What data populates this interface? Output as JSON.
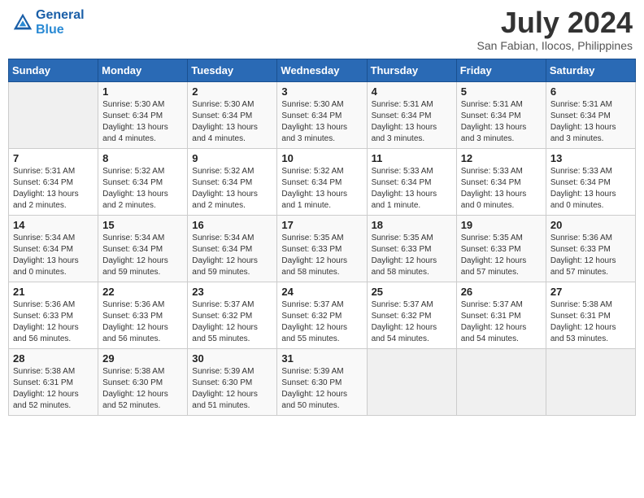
{
  "logo": {
    "line1": "General",
    "line2": "Blue"
  },
  "title": "July 2024",
  "location": "San Fabian, Ilocos, Philippines",
  "days_of_week": [
    "Sunday",
    "Monday",
    "Tuesday",
    "Wednesday",
    "Thursday",
    "Friday",
    "Saturday"
  ],
  "weeks": [
    [
      {
        "num": "",
        "info": ""
      },
      {
        "num": "1",
        "info": "Sunrise: 5:30 AM\nSunset: 6:34 PM\nDaylight: 13 hours\nand 4 minutes."
      },
      {
        "num": "2",
        "info": "Sunrise: 5:30 AM\nSunset: 6:34 PM\nDaylight: 13 hours\nand 4 minutes."
      },
      {
        "num": "3",
        "info": "Sunrise: 5:30 AM\nSunset: 6:34 PM\nDaylight: 13 hours\nand 3 minutes."
      },
      {
        "num": "4",
        "info": "Sunrise: 5:31 AM\nSunset: 6:34 PM\nDaylight: 13 hours\nand 3 minutes."
      },
      {
        "num": "5",
        "info": "Sunrise: 5:31 AM\nSunset: 6:34 PM\nDaylight: 13 hours\nand 3 minutes."
      },
      {
        "num": "6",
        "info": "Sunrise: 5:31 AM\nSunset: 6:34 PM\nDaylight: 13 hours\nand 3 minutes."
      }
    ],
    [
      {
        "num": "7",
        "info": "Sunrise: 5:31 AM\nSunset: 6:34 PM\nDaylight: 13 hours\nand 2 minutes."
      },
      {
        "num": "8",
        "info": "Sunrise: 5:32 AM\nSunset: 6:34 PM\nDaylight: 13 hours\nand 2 minutes."
      },
      {
        "num": "9",
        "info": "Sunrise: 5:32 AM\nSunset: 6:34 PM\nDaylight: 13 hours\nand 2 minutes."
      },
      {
        "num": "10",
        "info": "Sunrise: 5:32 AM\nSunset: 6:34 PM\nDaylight: 13 hours\nand 1 minute."
      },
      {
        "num": "11",
        "info": "Sunrise: 5:33 AM\nSunset: 6:34 PM\nDaylight: 13 hours\nand 1 minute."
      },
      {
        "num": "12",
        "info": "Sunrise: 5:33 AM\nSunset: 6:34 PM\nDaylight: 13 hours\nand 0 minutes."
      },
      {
        "num": "13",
        "info": "Sunrise: 5:33 AM\nSunset: 6:34 PM\nDaylight: 13 hours\nand 0 minutes."
      }
    ],
    [
      {
        "num": "14",
        "info": "Sunrise: 5:34 AM\nSunset: 6:34 PM\nDaylight: 13 hours\nand 0 minutes."
      },
      {
        "num": "15",
        "info": "Sunrise: 5:34 AM\nSunset: 6:34 PM\nDaylight: 12 hours\nand 59 minutes."
      },
      {
        "num": "16",
        "info": "Sunrise: 5:34 AM\nSunset: 6:34 PM\nDaylight: 12 hours\nand 59 minutes."
      },
      {
        "num": "17",
        "info": "Sunrise: 5:35 AM\nSunset: 6:33 PM\nDaylight: 12 hours\nand 58 minutes."
      },
      {
        "num": "18",
        "info": "Sunrise: 5:35 AM\nSunset: 6:33 PM\nDaylight: 12 hours\nand 58 minutes."
      },
      {
        "num": "19",
        "info": "Sunrise: 5:35 AM\nSunset: 6:33 PM\nDaylight: 12 hours\nand 57 minutes."
      },
      {
        "num": "20",
        "info": "Sunrise: 5:36 AM\nSunset: 6:33 PM\nDaylight: 12 hours\nand 57 minutes."
      }
    ],
    [
      {
        "num": "21",
        "info": "Sunrise: 5:36 AM\nSunset: 6:33 PM\nDaylight: 12 hours\nand 56 minutes."
      },
      {
        "num": "22",
        "info": "Sunrise: 5:36 AM\nSunset: 6:33 PM\nDaylight: 12 hours\nand 56 minutes."
      },
      {
        "num": "23",
        "info": "Sunrise: 5:37 AM\nSunset: 6:32 PM\nDaylight: 12 hours\nand 55 minutes."
      },
      {
        "num": "24",
        "info": "Sunrise: 5:37 AM\nSunset: 6:32 PM\nDaylight: 12 hours\nand 55 minutes."
      },
      {
        "num": "25",
        "info": "Sunrise: 5:37 AM\nSunset: 6:32 PM\nDaylight: 12 hours\nand 54 minutes."
      },
      {
        "num": "26",
        "info": "Sunrise: 5:37 AM\nSunset: 6:31 PM\nDaylight: 12 hours\nand 54 minutes."
      },
      {
        "num": "27",
        "info": "Sunrise: 5:38 AM\nSunset: 6:31 PM\nDaylight: 12 hours\nand 53 minutes."
      }
    ],
    [
      {
        "num": "28",
        "info": "Sunrise: 5:38 AM\nSunset: 6:31 PM\nDaylight: 12 hours\nand 52 minutes."
      },
      {
        "num": "29",
        "info": "Sunrise: 5:38 AM\nSunset: 6:30 PM\nDaylight: 12 hours\nand 52 minutes."
      },
      {
        "num": "30",
        "info": "Sunrise: 5:39 AM\nSunset: 6:30 PM\nDaylight: 12 hours\nand 51 minutes."
      },
      {
        "num": "31",
        "info": "Sunrise: 5:39 AM\nSunset: 6:30 PM\nDaylight: 12 hours\nand 50 minutes."
      },
      {
        "num": "",
        "info": ""
      },
      {
        "num": "",
        "info": ""
      },
      {
        "num": "",
        "info": ""
      }
    ]
  ]
}
